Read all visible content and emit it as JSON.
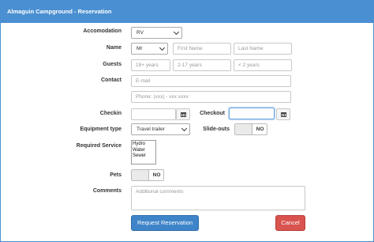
{
  "window": {
    "title": "Almaguin Campground - Reservation"
  },
  "form": {
    "accommodation": {
      "label": "Accomodation",
      "value": "RV"
    },
    "name": {
      "label": "Name",
      "title_value": "Mr",
      "first_placeholder": "First Name",
      "last_placeholder": "Last Name"
    },
    "guests": {
      "label": "Guests",
      "adults_placeholder": "18+ years",
      "children_placeholder": "2-17 years",
      "infants_placeholder": "< 2 years"
    },
    "contact": {
      "label": "Contact",
      "email_placeholder": "E-mail",
      "phone_placeholder": "Phone: (xxx) - xxx xxxx"
    },
    "checkin": {
      "label": "Checkin"
    },
    "checkout": {
      "label": "Checkout"
    },
    "equipment": {
      "label": "Equipment type",
      "value": "Travel trailer"
    },
    "slideouts": {
      "label": "Slide-outs",
      "state": "NO"
    },
    "services": {
      "label": "Required Service",
      "options": [
        "Hydro",
        "Water",
        "Sewer"
      ]
    },
    "pets": {
      "label": "Pets",
      "state": "NO"
    },
    "comments": {
      "label": "Comments",
      "placeholder": "Additional comments"
    }
  },
  "actions": {
    "submit_label": "Request Reservation",
    "cancel_label": "Cancel"
  },
  "colors": {
    "accent": "#4a8fd1",
    "primary": "#3e84c8",
    "danger": "#d9534f"
  }
}
